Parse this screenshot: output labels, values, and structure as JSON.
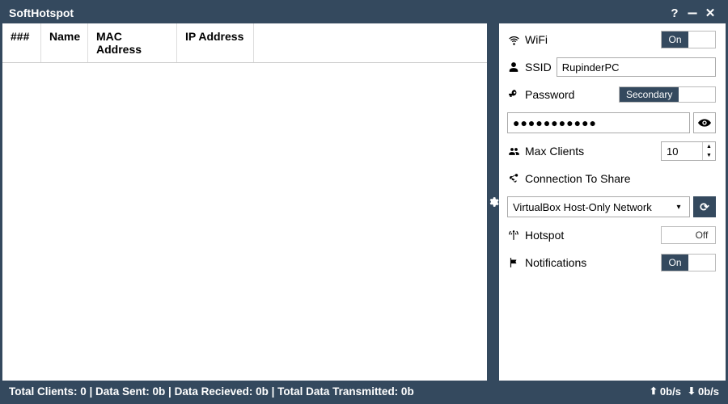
{
  "window": {
    "title": "SoftHotspot"
  },
  "table": {
    "columns": {
      "index": "###",
      "name": "Name",
      "mac": "MAC Address",
      "ip": "IP Address"
    }
  },
  "settings": {
    "wifi": {
      "label": "WiFi",
      "value": "On"
    },
    "ssid": {
      "label": "SSID",
      "value": "RupinderPC"
    },
    "password": {
      "label": "Password",
      "badge": "Secondary",
      "mask": "●●●●●●●●●●●"
    },
    "max_clients": {
      "label": "Max Clients",
      "value": "10"
    },
    "connection": {
      "label": "Connection To Share",
      "selected": "VirtualBox Host-Only Network"
    },
    "hotspot": {
      "label": "Hotspot",
      "value": "Off"
    },
    "notifications": {
      "label": "Notifications",
      "value": "On"
    }
  },
  "status": {
    "text": "Total Clients: 0 | Data Sent: 0b | Data Recieved: 0b | Total Data Transmitted: 0b",
    "upload": "0b/s",
    "download": "0b/s"
  }
}
